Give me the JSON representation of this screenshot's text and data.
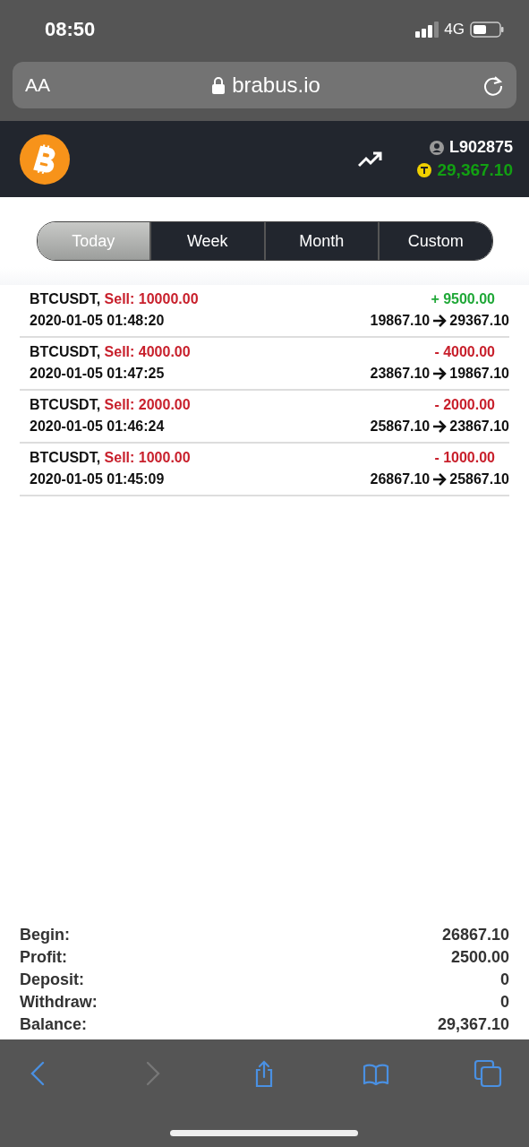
{
  "status_bar": {
    "time": "08:50",
    "network": "4G"
  },
  "address_bar": {
    "text_size": "AA",
    "url": "brabus.io"
  },
  "header": {
    "account": "L902875",
    "balance": "29,367.10"
  },
  "tabs": [
    {
      "label": "Today",
      "selected": true
    },
    {
      "label": "Week",
      "selected": false
    },
    {
      "label": "Month",
      "selected": false
    },
    {
      "label": "Custom",
      "selected": false
    }
  ],
  "trades": [
    {
      "symbol": "BTCUSDT,",
      "side": "Sell: 10000.00",
      "time": "2020-01-05 01:48:20",
      "change": "+ 9500.00",
      "color": "#20a838",
      "from": "19867.10",
      "to": "29367.10"
    },
    {
      "symbol": "BTCUSDT,",
      "side": "Sell: 4000.00",
      "time": "2020-01-05 01:47:25",
      "change": "- 4000.00",
      "color": "#c8202c",
      "from": "23867.10",
      "to": "19867.10"
    },
    {
      "symbol": "BTCUSDT,",
      "side": "Sell: 2000.00",
      "time": "2020-01-05 01:46:24",
      "change": "- 2000.00",
      "color": "#c8202c",
      "from": "25867.10",
      "to": "23867.10"
    },
    {
      "symbol": "BTCUSDT,",
      "side": "Sell: 1000.00",
      "time": "2020-01-05 01:45:09",
      "change": "- 1000.00",
      "color": "#c8202c",
      "from": "26867.10",
      "to": "25867.10"
    }
  ],
  "summary": [
    {
      "label": "Begin:",
      "value": "26867.10"
    },
    {
      "label": "Profit:",
      "value": "2500.00"
    },
    {
      "label": "Deposit:",
      "value": "0"
    },
    {
      "label": "Withdraw:",
      "value": "0"
    },
    {
      "label": "Balance:",
      "value": "29,367.10"
    }
  ],
  "toolbar": [
    {
      "kind": "back",
      "disabled": false
    },
    {
      "kind": "forward",
      "disabled": true
    },
    {
      "kind": "share",
      "disabled": false
    },
    {
      "kind": "bookmarks",
      "disabled": false
    },
    {
      "kind": "tabs",
      "disabled": false
    }
  ]
}
